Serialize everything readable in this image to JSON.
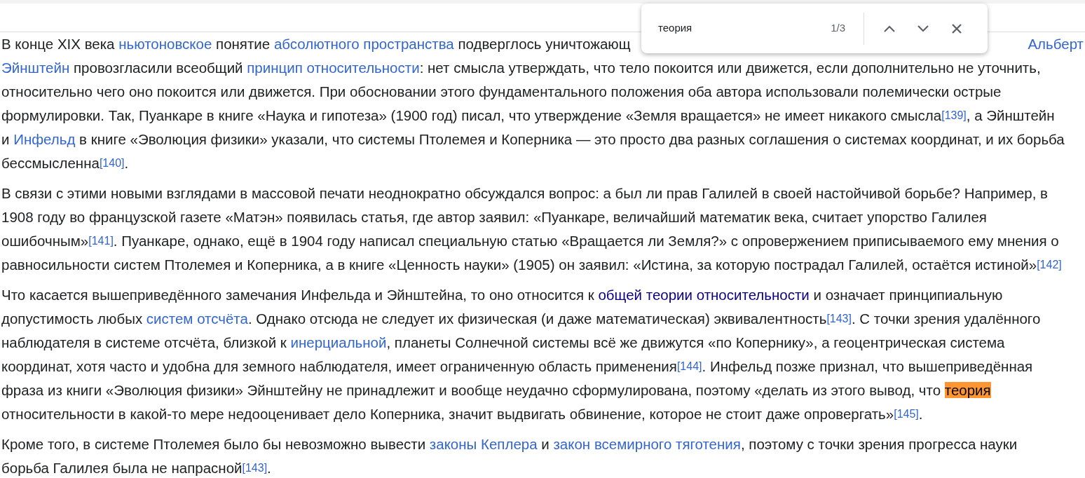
{
  "find_bar": {
    "query": "теория",
    "count": "1/3"
  },
  "top_line": {
    "left": [
      {
        "kind": "text",
        "text": "В конце XIX века "
      },
      {
        "kind": "link",
        "text": "ньютоновское"
      },
      {
        "kind": "text",
        "text": " понятие "
      },
      {
        "kind": "link",
        "text": "абсолютного пространства"
      },
      {
        "kind": "text",
        "text": " подверглось уничтожающ"
      }
    ],
    "right": [
      {
        "kind": "link",
        "text": "Альберт"
      }
    ]
  },
  "paragraphs": [
    {
      "lines": [
        [
          {
            "kind": "link",
            "text": "Эйнштейн"
          },
          {
            "kind": "text",
            "text": " провозгласили всеобщий "
          },
          {
            "kind": "link",
            "text": "принцип относительности"
          },
          {
            "kind": "text",
            "text": ": нет смысла утверждать, что тело покоится или движется, если дополнительно не уточнить,"
          }
        ],
        [
          {
            "kind": "text",
            "text": "относительно чего оно покоится или движется. При обосновании этого фундаментального положения оба автора использовали полемически острые"
          }
        ],
        [
          {
            "kind": "text",
            "text": "формулировки. Так, Пуанкаре в книге «Наука и гипотеза» (1900 год) писал, что утверждение «Земля вращается» не имеет никакого смысла"
          },
          {
            "kind": "ref",
            "text": "[139]"
          },
          {
            "kind": "text",
            "text": ", а Эйнштейн"
          }
        ],
        [
          {
            "kind": "text",
            "text": "и "
          },
          {
            "kind": "link",
            "text": "Инфельд"
          },
          {
            "kind": "text",
            "text": " в книге «Эволюция физики» указали, что системы Птолемея и Коперника — это просто два разных соглашения о системах координат, и их борьба"
          }
        ],
        [
          {
            "kind": "text",
            "text": "бессмысленна"
          },
          {
            "kind": "ref",
            "text": "[140]"
          },
          {
            "kind": "text",
            "text": "."
          }
        ]
      ]
    },
    {
      "lines": [
        [
          {
            "kind": "text",
            "text": "В связи с этими новыми взглядами в массовой печати неоднократно обсуждался вопрос: а был ли прав Галилей в своей настойчивой борьбе? Например, в"
          }
        ],
        [
          {
            "kind": "text",
            "text": "1908 году во французской газете «Матэн» появилась статья, где автор заявил: «Пуанкаре, величайший математик века, считает упорство Галилея"
          }
        ],
        [
          {
            "kind": "text",
            "text": "ошибочным»"
          },
          {
            "kind": "ref",
            "text": "[141]"
          },
          {
            "kind": "text",
            "text": ". Пуанкаре, однако, ещё в 1904 году написал специальную статью «Вращается ли Земля?» с опровержением приписываемого ему мнения о"
          }
        ],
        [
          {
            "kind": "text",
            "text": "равносильности систем Птолемея и Коперника, а в книге «Ценность науки» (1905) он заявил: «Истина, за которую пострадал Галилей, остаётся истиной»"
          },
          {
            "kind": "ref",
            "text": "[142]"
          }
        ]
      ]
    },
    {
      "lines": [
        [
          {
            "kind": "text",
            "text": "Что касается вышеприведённого замечания Инфельда и Эйнштейна, то оно относится к "
          },
          {
            "kind": "visited_link",
            "text": "общей теории относительности"
          },
          {
            "kind": "text",
            "text": " и означает принципиальную"
          }
        ],
        [
          {
            "kind": "text",
            "text": "допустимость любых "
          },
          {
            "kind": "link",
            "text": "систем отсчёта"
          },
          {
            "kind": "text",
            "text": ". Однако отсюда не следует их физическая (и даже математическая) эквивалентность"
          },
          {
            "kind": "ref",
            "text": "[143]"
          },
          {
            "kind": "text",
            "text": ". С точки зрения удалённого"
          }
        ],
        [
          {
            "kind": "text",
            "text": "наблюдателя в системе отсчёта, близкой к "
          },
          {
            "kind": "link",
            "text": "инерциальной"
          },
          {
            "kind": "text",
            "text": ", планеты Солнечной системы всё же движутся «по Копернику», а геоцентрическая система"
          }
        ],
        [
          {
            "kind": "text",
            "text": "координат, хотя часто и удобна для земного наблюдателя, имеет ограниченную область применения"
          },
          {
            "kind": "ref",
            "text": "[144]"
          },
          {
            "kind": "text",
            "text": ". Инфельд позже признал, что вышеприведённая"
          }
        ],
        [
          {
            "kind": "text",
            "text": "фраза из книги «Эволюция физики» Эйнштейну не принадлежит и вообще неудачно сформулирована, поэтому «делать из этого вывод, что "
          },
          {
            "kind": "match",
            "text": "теория"
          }
        ],
        [
          {
            "kind": "text",
            "text": "относительности в какой-то мере недооценивает дело Коперника, значит выдвигать обвинение, которое не стоит даже опровергать»"
          },
          {
            "kind": "ref",
            "text": "[145]"
          },
          {
            "kind": "text",
            "text": "."
          }
        ]
      ]
    },
    {
      "lines": [
        [
          {
            "kind": "text",
            "text": "Кроме того, в системе Птолемея было бы невозможно вывести "
          },
          {
            "kind": "link",
            "text": "законы Кеплера"
          },
          {
            "kind": "text",
            "text": " и "
          },
          {
            "kind": "link",
            "text": "закон всемирного тяготения"
          },
          {
            "kind": "text",
            "text": ", поэтому с точки зрения прогресса науки"
          }
        ],
        [
          {
            "kind": "text",
            "text": "борьба Галилея была не напрасной"
          },
          {
            "kind": "ref",
            "text": "[143]"
          },
          {
            "kind": "text",
            "text": "."
          }
        ]
      ]
    }
  ]
}
